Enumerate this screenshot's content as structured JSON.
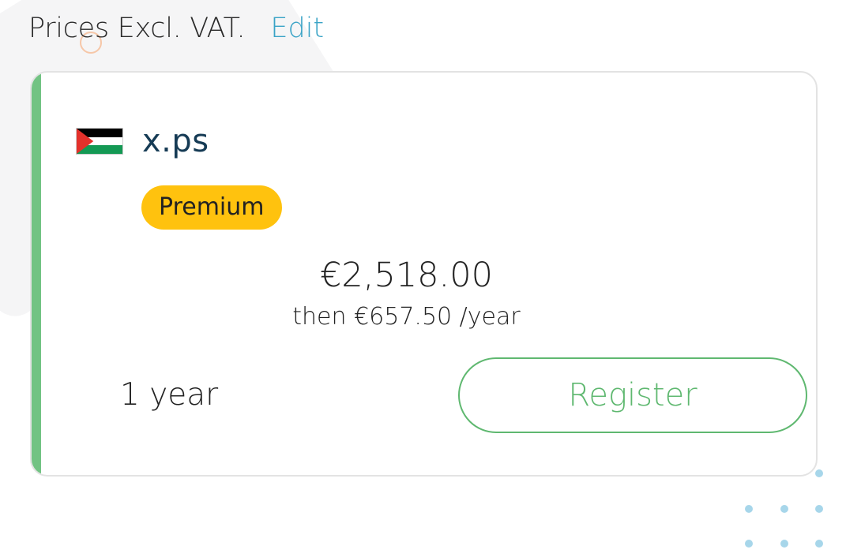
{
  "header": {
    "prices_label": "Prices Excl. VAT.",
    "edit_link": "Edit"
  },
  "domain_card": {
    "flag_icon": "palestine-flag-icon",
    "domain_name": "x.ps",
    "badge": "Premium",
    "price": "€2,518.00",
    "renewal": "then €657.50 /year",
    "period": "1 year",
    "register_button": "Register"
  },
  "colors": {
    "accent_green": "#72c383",
    "register_green": "#5fb870",
    "badge_yellow": "#ffc20e",
    "edit_blue": "#3aa3c6",
    "domain_navy": "#163b55"
  }
}
